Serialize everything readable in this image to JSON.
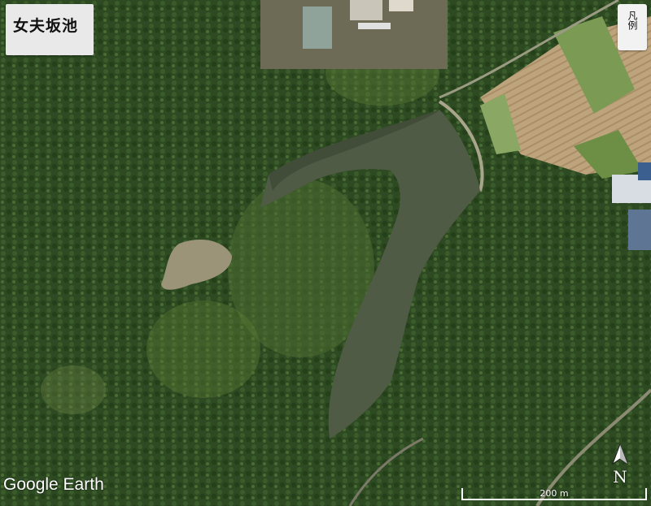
{
  "title": "女夫坂池",
  "legend_button": "凡例",
  "attribution": "Google Earth",
  "north_label": "N",
  "scale_label": "200 m",
  "colors": {
    "forest": "#2f4d24",
    "water": "#4d5a43",
    "field": "#b9a27c",
    "title_bg": "#e9e9e9"
  }
}
